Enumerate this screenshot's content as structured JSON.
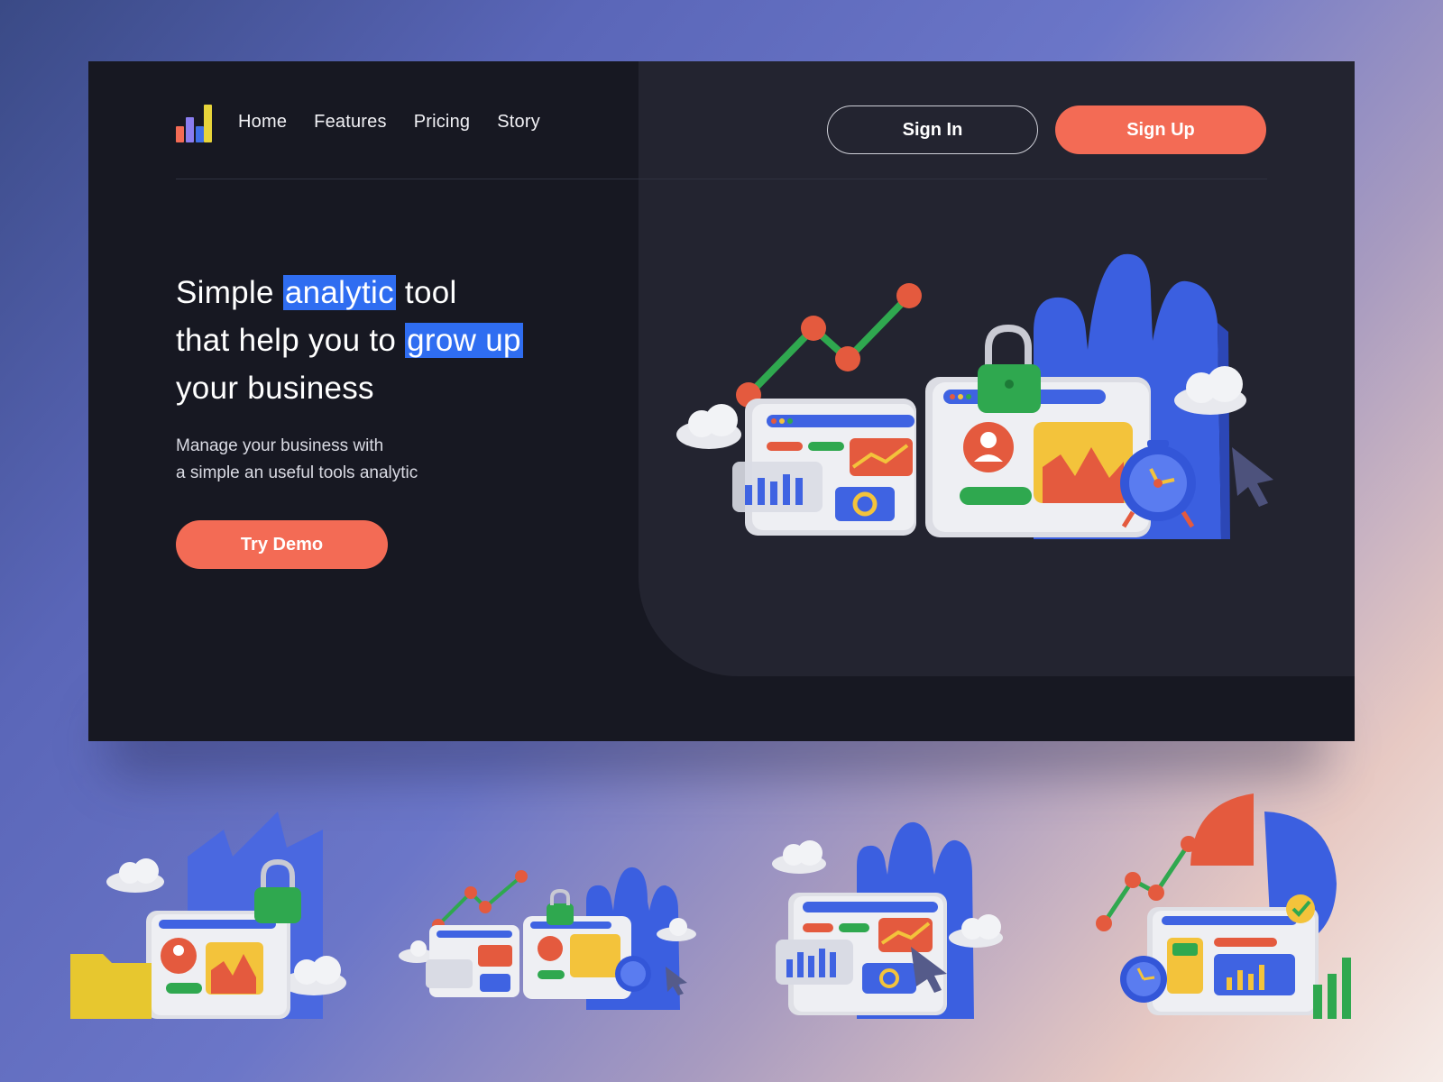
{
  "nav": {
    "items": [
      {
        "label": "Home"
      },
      {
        "label": "Features"
      },
      {
        "label": "Pricing"
      },
      {
        "label": "Story"
      }
    ],
    "sign_in": "Sign In",
    "sign_up": "Sign Up"
  },
  "hero": {
    "title_part1": "Simple ",
    "title_highlight1": "analytic",
    "title_part2": " tool",
    "title_part3": "that help you to ",
    "title_highlight2": "grow up",
    "title_part4": "your business",
    "desc_line1": "Manage your business with",
    "desc_line2": "a simple an useful tools analytic",
    "cta": "Try Demo"
  },
  "colors": {
    "accent": "#f36b55",
    "highlight": "#2f6df1",
    "background": "#171822",
    "panel": "#232430"
  },
  "icons": [
    "bar-chart-logo-icon",
    "line-chart-icon",
    "lock-icon",
    "user-icon",
    "alarm-clock-icon",
    "cursor-icon",
    "cloud-icon",
    "folder-icon",
    "pie-chart-icon",
    "check-icon"
  ]
}
